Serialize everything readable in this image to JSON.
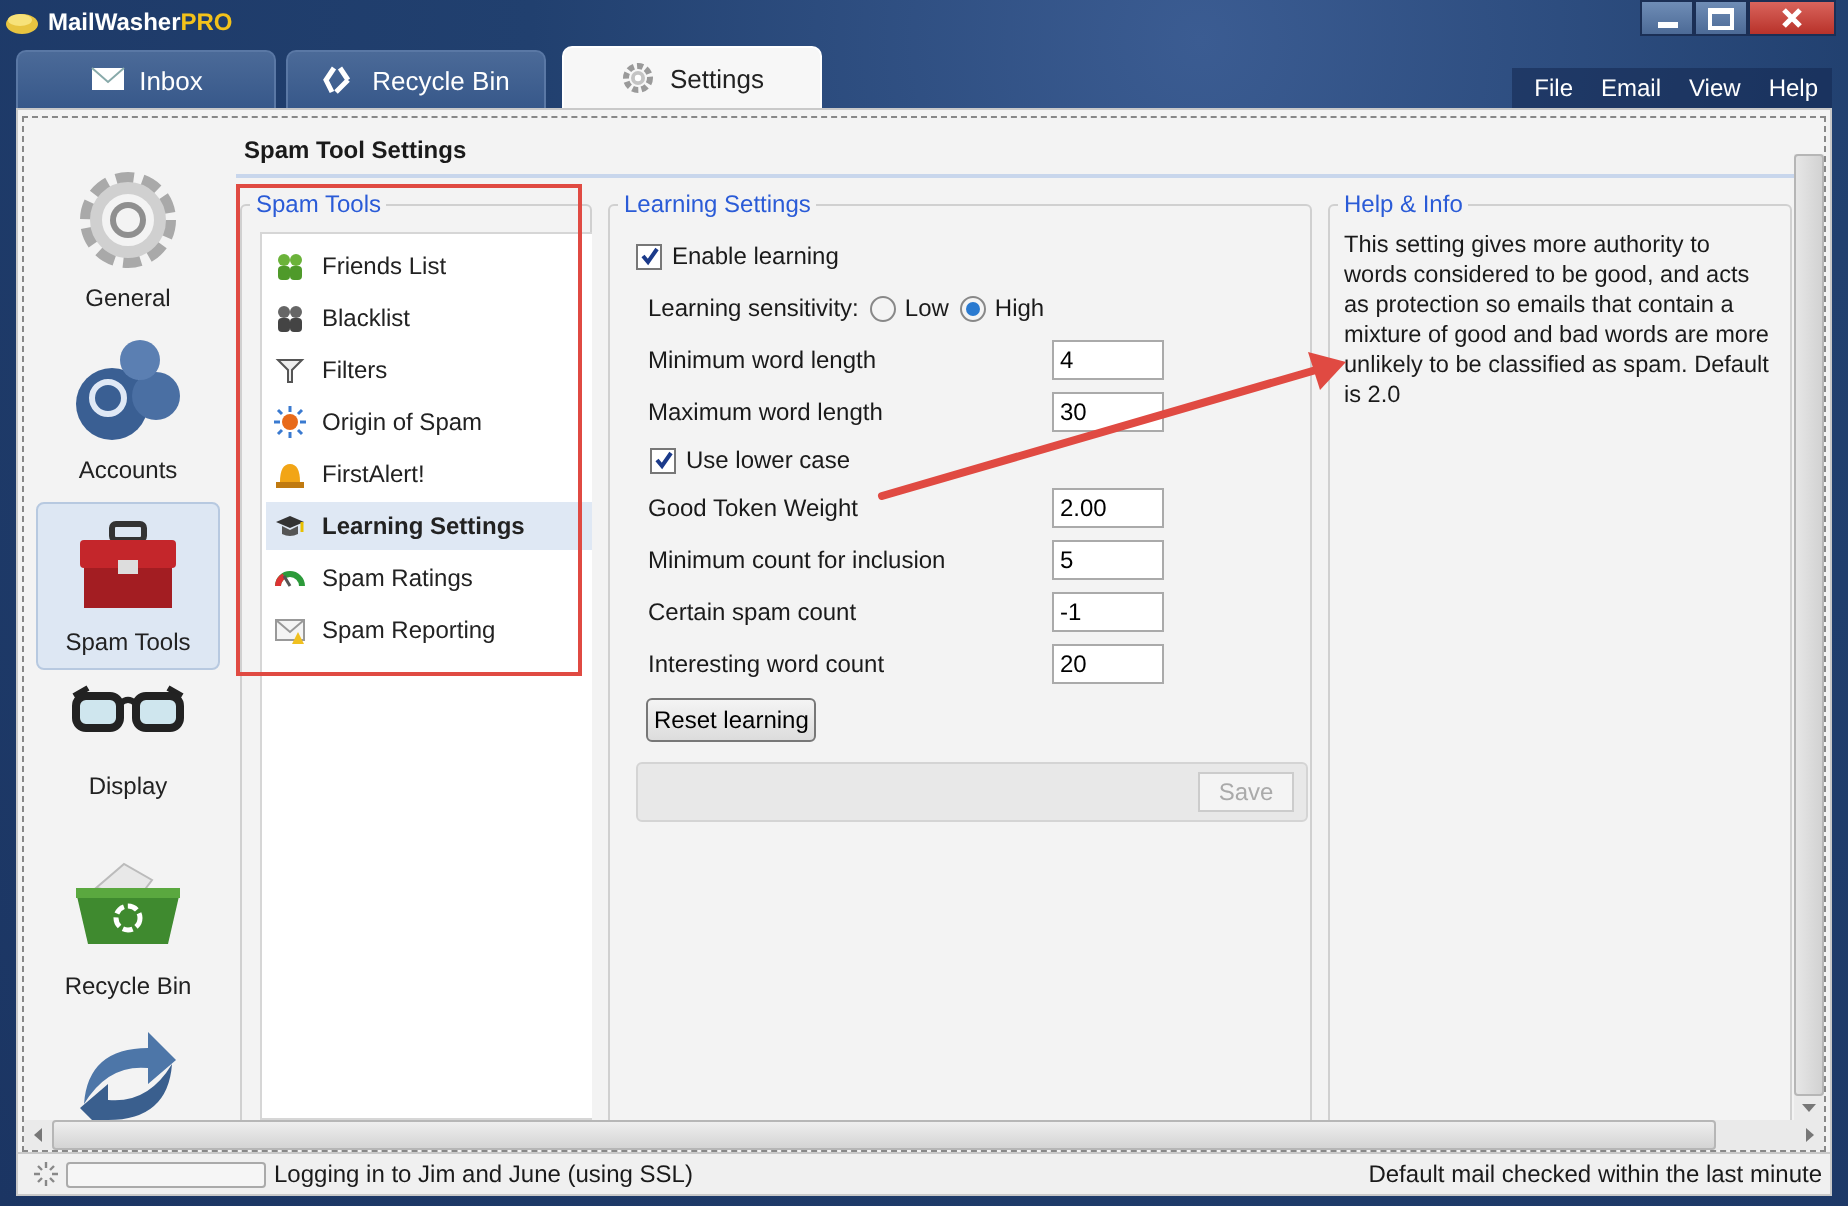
{
  "window": {
    "title": "MailWasher",
    "edition": "PRO"
  },
  "tabs": [
    {
      "label": "Inbox",
      "selected": false
    },
    {
      "label": "Recycle Bin",
      "selected": false
    },
    {
      "label": "Settings",
      "selected": true
    }
  ],
  "menu": [
    "File",
    "Email",
    "View",
    "Help"
  ],
  "sidebar": {
    "items": [
      {
        "label": "General",
        "selected": false
      },
      {
        "label": "Accounts",
        "selected": false
      },
      {
        "label": "Spam Tools",
        "selected": true
      },
      {
        "label": "Display",
        "selected": false
      },
      {
        "label": "Recycle Bin",
        "selected": false
      },
      {
        "selected": false
      }
    ]
  },
  "heading": "Spam Tool Settings",
  "spam_tools": {
    "title": "Spam Tools",
    "items": [
      {
        "label": "Friends List",
        "selected": false
      },
      {
        "label": "Blacklist",
        "selected": false
      },
      {
        "label": "Filters",
        "selected": false
      },
      {
        "label": "Origin of Spam",
        "selected": false
      },
      {
        "label": "FirstAlert!",
        "selected": false
      },
      {
        "label": "Learning Settings",
        "selected": true
      },
      {
        "label": "Spam Ratings",
        "selected": false
      },
      {
        "label": "Spam Reporting",
        "selected": false
      }
    ]
  },
  "learning": {
    "title": "Learning Settings",
    "enable": {
      "label": "Enable learning",
      "checked": true
    },
    "rows": [
      {
        "kind": "radio",
        "label": "Learning sensitivity:",
        "options": [
          {
            "label": "Low",
            "selected": false
          },
          {
            "label": "High",
            "selected": true
          }
        ]
      },
      {
        "kind": "field",
        "label": "Minimum word length",
        "value": "4"
      },
      {
        "kind": "field",
        "label": "Maximum word length",
        "value": "30"
      },
      {
        "kind": "checkbox",
        "label": "Use lower case",
        "checked": true
      },
      {
        "kind": "field",
        "label": "Good Token Weight",
        "value": "2.00"
      },
      {
        "kind": "field",
        "label": "Minimum count for inclusion",
        "value": "5"
      },
      {
        "kind": "field",
        "label": "Certain spam count",
        "value": "-1"
      },
      {
        "kind": "field",
        "label": "Interesting word count",
        "value": "20"
      }
    ],
    "reset_button": "Reset learning",
    "save_button": {
      "label": "Save",
      "disabled": true
    }
  },
  "help": {
    "title": "Help & Info",
    "text": "This setting gives more authority to words considered to be good, and acts as protection so emails that contain a mixture of good and bad words are more unlikely to be classified as spam. Default is 2.0"
  },
  "status_bar": {
    "progress": {
      "level": 0
    },
    "left": "Logging in to Jim and June (using SSL)",
    "right": "Default mail checked within the last minute"
  }
}
